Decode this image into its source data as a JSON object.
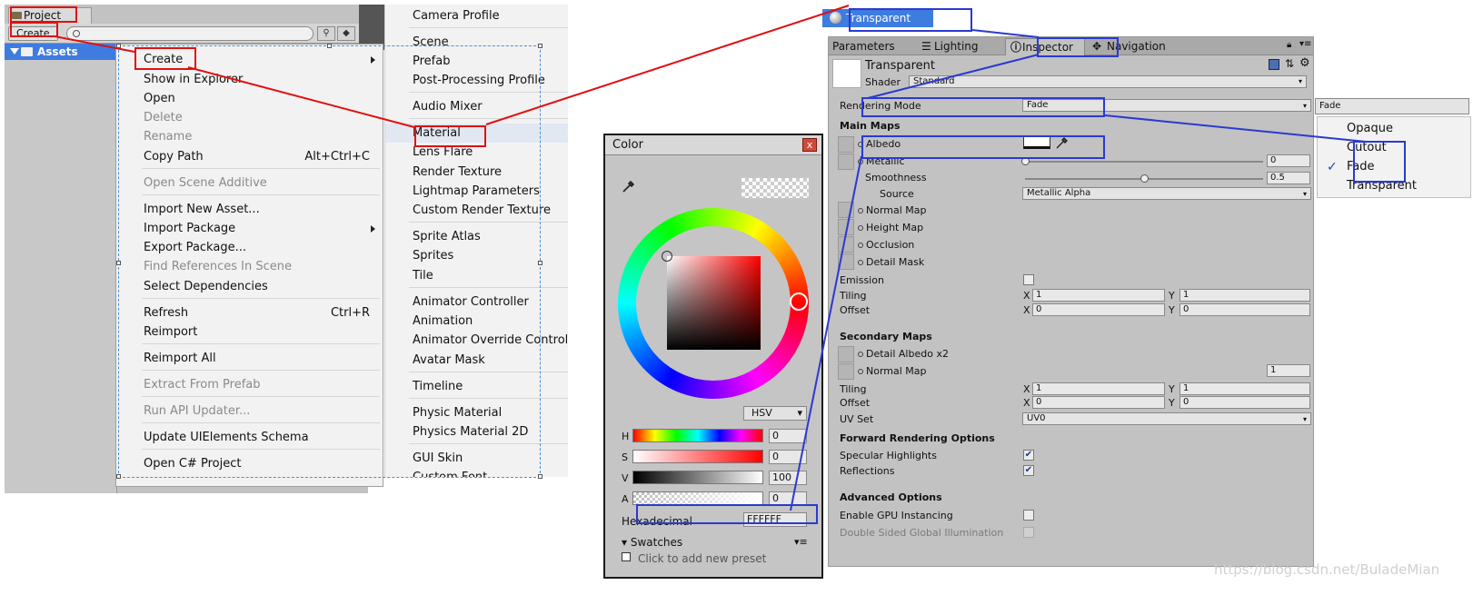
{
  "project": {
    "tab_label": "Project",
    "create_button": "Create",
    "search_placeholder": "",
    "assets_label": "Assets"
  },
  "context_menu": {
    "items": [
      {
        "label": "Create",
        "enabled": true,
        "submenu": true
      },
      {
        "label": "Show in Explorer",
        "enabled": true
      },
      {
        "label": "Open",
        "enabled": true
      },
      {
        "label": "Delete",
        "enabled": false
      },
      {
        "label": "Rename",
        "enabled": false
      },
      {
        "label": "Copy Path",
        "enabled": true,
        "shortcut": "Alt+Ctrl+C"
      },
      {
        "label": "Open Scene Additive",
        "enabled": false
      },
      {
        "label": "Import New Asset...",
        "enabled": true
      },
      {
        "label": "Import Package",
        "enabled": true,
        "submenu": true
      },
      {
        "label": "Export Package...",
        "enabled": true
      },
      {
        "label": "Find References In Scene",
        "enabled": false
      },
      {
        "label": "Select Dependencies",
        "enabled": true
      },
      {
        "label": "Refresh",
        "enabled": true,
        "shortcut": "Ctrl+R"
      },
      {
        "label": "Reimport",
        "enabled": true
      },
      {
        "label": "Reimport All",
        "enabled": true
      },
      {
        "label": "Extract From Prefab",
        "enabled": false
      },
      {
        "label": "Run API Updater...",
        "enabled": false
      },
      {
        "label": "Update UIElements Schema",
        "enabled": true
      },
      {
        "label": "Open C# Project",
        "enabled": true
      }
    ]
  },
  "create_submenu": {
    "items": [
      "Camera Profile",
      "Scene",
      "Prefab",
      "Post-Processing Profile",
      "Audio Mixer",
      "Material",
      "Lens Flare",
      "Render Texture",
      "Lightmap Parameters",
      "Custom Render Texture",
      "Sprite Atlas",
      "Sprites",
      "Tile",
      "Animator Controller",
      "Animation",
      "Animator Override Controller",
      "Avatar Mask",
      "Timeline",
      "Physic Material",
      "Physics Material 2D",
      "GUI Skin",
      "Custom Font"
    ],
    "highlighted": "Material"
  },
  "color_window": {
    "title": "Color",
    "close": "x",
    "mode": "HSV",
    "sliders": [
      {
        "label": "H",
        "value": "0"
      },
      {
        "label": "S",
        "value": "0"
      },
      {
        "label": "V",
        "value": "100"
      },
      {
        "label": "A",
        "value": "0"
      }
    ],
    "hex_label": "Hexadecimal",
    "hex_value": "FFFFFF",
    "swatches_label": "Swatches",
    "preset_hint": "Click to add new preset"
  },
  "material_label": "Transparent",
  "inspector": {
    "tabs": [
      "Parameters",
      "Lighting",
      "Inspector",
      "Navigation"
    ],
    "active_tab": "Inspector",
    "material_name": "Transparent",
    "shader_label": "Shader",
    "shader_value": "Standard",
    "rendering_mode_label": "Rendering Mode",
    "rendering_mode_value": "Fade",
    "main_maps_header": "Main Maps",
    "albedo_label": "Albedo",
    "metallic_label": "Metallic",
    "metallic_value": "0",
    "smoothness_label": "Smoothness",
    "smoothness_value": "0.5",
    "smoothness_fraction": 0.5,
    "metallic_fraction": 0.0,
    "source_label": "Source",
    "source_value": "Metallic Alpha",
    "normal_map_label": "Normal Map",
    "height_map_label": "Height Map",
    "occlusion_label": "Occlusion",
    "detail_mask_label": "Detail Mask",
    "emission_label": "Emission",
    "tiling_label": "Tiling",
    "offset_label": "Offset",
    "main_tiling": {
      "x": "1",
      "y": "1"
    },
    "main_offset": {
      "x": "0",
      "y": "0"
    },
    "secondary_header": "Secondary Maps",
    "detail_albedo_label": "Detail Albedo x2",
    "secondary_normal_label": "Normal Map",
    "secondary_normal_value": "1",
    "secondary_tiling": {
      "x": "1",
      "y": "1"
    },
    "secondary_offset": {
      "x": "0",
      "y": "0"
    },
    "uv_set_label": "UV Set",
    "uv_set_value": "UV0",
    "forward_header": "Forward Rendering Options",
    "specular_label": "Specular Highlights",
    "specular_checked": true,
    "reflections_label": "Reflections",
    "reflections_checked": true,
    "advanced_header": "Advanced Options",
    "gpu_instancing_label": "Enable GPU Instancing",
    "double_sided_label": "Double Sided Global Illumination",
    "x_label": "X",
    "y_label": "Y"
  },
  "fade_dropdown": {
    "value": "Fade",
    "options": [
      "Opaque",
      "Cutout",
      "Fade",
      "Transparent"
    ],
    "selected": "Fade"
  },
  "watermark": "https://blog.csdn.net/BuladeMian",
  "colors": {
    "selection_blue": "#3e7ce0",
    "annotation_red": "#e01010",
    "annotation_blue": "#2a3ad0"
  }
}
